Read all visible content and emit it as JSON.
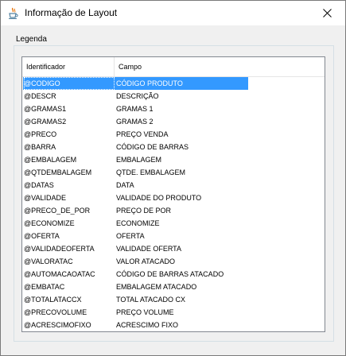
{
  "window": {
    "title": "Informação de Layout"
  },
  "icons": {
    "app": "java-cup-icon",
    "close": "close-icon"
  },
  "legend": {
    "label": "Legenda"
  },
  "table": {
    "columns": [
      "Identificador",
      "Campo"
    ],
    "selected_index": 0,
    "rows": [
      {
        "id": "@CODIGO",
        "campo": "CÓDIGO PRODUTO"
      },
      {
        "id": "@DESCR",
        "campo": "DESCRIÇÃO"
      },
      {
        "id": "@GRAMAS1",
        "campo": "GRAMAS 1"
      },
      {
        "id": "@GRAMAS2",
        "campo": "GRAMAS 2"
      },
      {
        "id": "@PRECO",
        "campo": "PREÇO VENDA"
      },
      {
        "id": "@BARRA",
        "campo": "CÓDIGO DE BARRAS"
      },
      {
        "id": "@EMBALAGEM",
        "campo": "EMBALAGEM"
      },
      {
        "id": "@QTDEMBALAGEM",
        "campo": "QTDE. EMBALAGEM"
      },
      {
        "id": "@DATAS",
        "campo": "DATA"
      },
      {
        "id": "@VALIDADE",
        "campo": "VALIDADE DO PRODUTO"
      },
      {
        "id": "@PRECO_DE_POR",
        "campo": "PREÇO DE POR"
      },
      {
        "id": "@ECONOMIZE",
        "campo": "ECONOMIZE"
      },
      {
        "id": "@OFERTA",
        "campo": "OFERTA"
      },
      {
        "id": "@VALIDADEOFERTA",
        "campo": "VALIDADE OFERTA"
      },
      {
        "id": "@VALORATAC",
        "campo": "VALOR ATACADO"
      },
      {
        "id": "@AUTOMACAOATAC",
        "campo": "CÓDIGO DE BARRAS ATACADO"
      },
      {
        "id": "@EMBATAC",
        "campo": "EMBALAGEM ATACADO"
      },
      {
        "id": "@TOTALATACCX",
        "campo": "TOTAL ATACADO CX"
      },
      {
        "id": "@PRECOVOLUME",
        "campo": "PREÇO VOLUME"
      },
      {
        "id": "@ACRESCIMOFIXO",
        "campo": "ACRESCIMO FIXO"
      }
    ]
  },
  "colors": {
    "selection": "#3399ff",
    "window_bg": "#f0f0f0"
  }
}
